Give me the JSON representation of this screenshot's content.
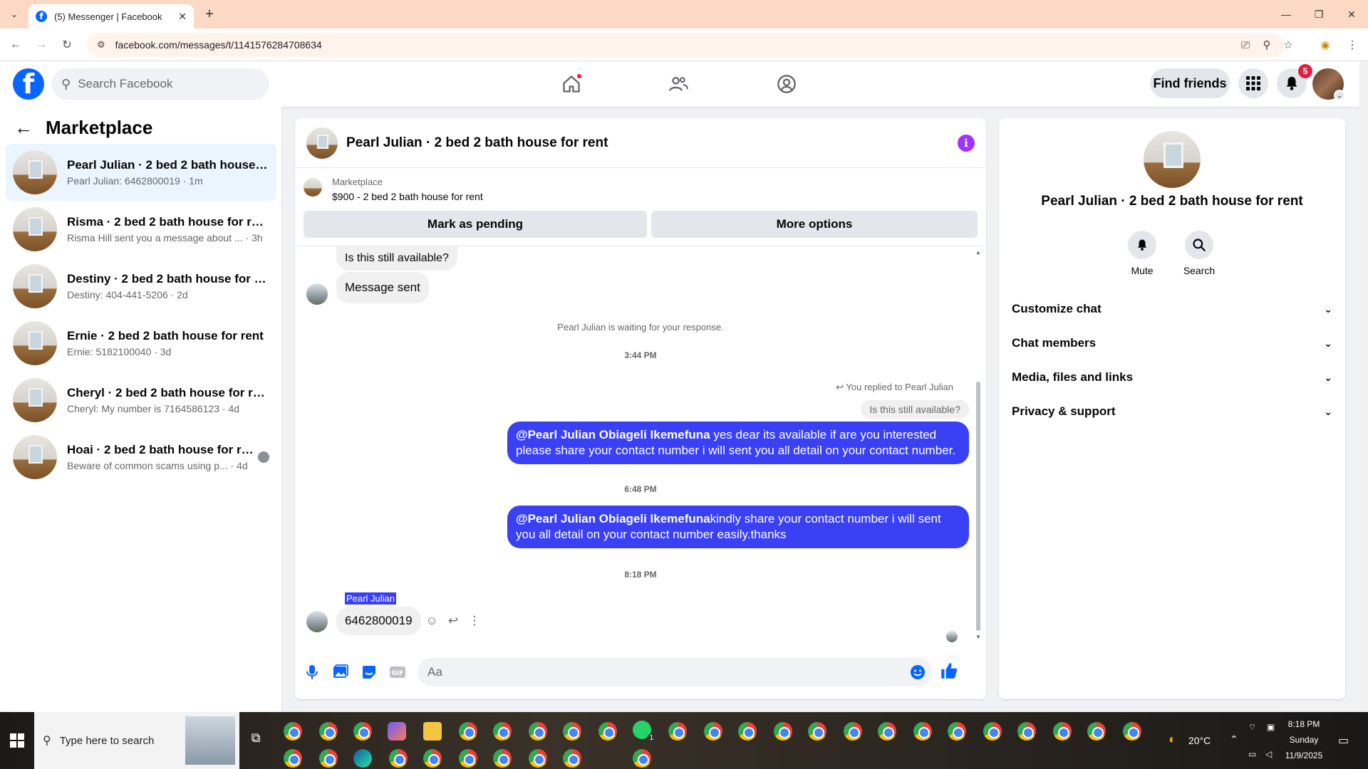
{
  "browser": {
    "tab_title": "(5) Messenger | Facebook",
    "url": "facebook.com/messages/t/1141576284708634"
  },
  "header": {
    "search_placeholder": "Search Facebook",
    "find_friends": "Find friends",
    "notifications_count": "5"
  },
  "sidebar": {
    "title": "Marketplace",
    "conversations": [
      {
        "name": "Pearl Julian · 2 bed 2 bath house f...",
        "sub": "Pearl Julian: 6462800019 · 1m",
        "active": true
      },
      {
        "name": "Risma · 2 bed 2 bath house for rent",
        "sub": "Risma Hill sent you a message about ... · 3h"
      },
      {
        "name": "Destiny · 2 bed 2 bath house for re...",
        "sub": "Destiny: 404-441-5206 · 2d"
      },
      {
        "name": "Ernie · 2 bed 2 bath house for rent",
        "sub": "Ernie: 5182100040 · 3d"
      },
      {
        "name": "Cheryl · 2 bed 2 bath house for rent",
        "sub": "Cheryl: My number is 7164586123 · 4d"
      },
      {
        "name": "Hoai · 2 bed 2 bath house for rent",
        "sub": "Beware of common scams using p... · 4d"
      }
    ]
  },
  "chat": {
    "title": "Pearl Julian · 2 bed 2 bath house for rent",
    "listing_label": "Marketplace",
    "listing_price": "$900 - 2 bed 2 bath house for rent",
    "mark_pending": "Mark as pending",
    "more_options": "More options",
    "msg_available": "Is this still available?",
    "msg_sent": "Message sent",
    "waiting": "Pearl Julian is waiting for your response.",
    "time1": "3:44 PM",
    "replied_label": "You replied to Pearl Julian",
    "quoted": "Is this still available?",
    "out1_mention": "@Pearl Julian Obiageli Ikemefuna",
    "out1_text": " yes dear its available if are you interested please share your contact number i will sent you all detail on your contact number.",
    "time2": "6:48 PM",
    "out2_mention": "@Pearl Julian Obiageli Ikemefuna",
    "out2_text": "kindly share your contact number i will sent you all detail on your contact number easily.thanks",
    "time3": "8:18 PM",
    "sender": "Pearl Julian",
    "last_msg": "6462800019",
    "composer_placeholder": "Aa"
  },
  "info_panel": {
    "name": "Pearl Julian · 2 bed 2 bath house for rent",
    "mute": "Mute",
    "search": "Search",
    "rows": [
      "Customize chat",
      "Chat members",
      "Media, files and links",
      "Privacy & support"
    ]
  },
  "taskbar": {
    "search_placeholder": "Type here to search",
    "weather": "20°C",
    "time": "8:18 PM",
    "day": "Sunday",
    "date": "11/9/2025",
    "whatsapp_badge": "1"
  }
}
